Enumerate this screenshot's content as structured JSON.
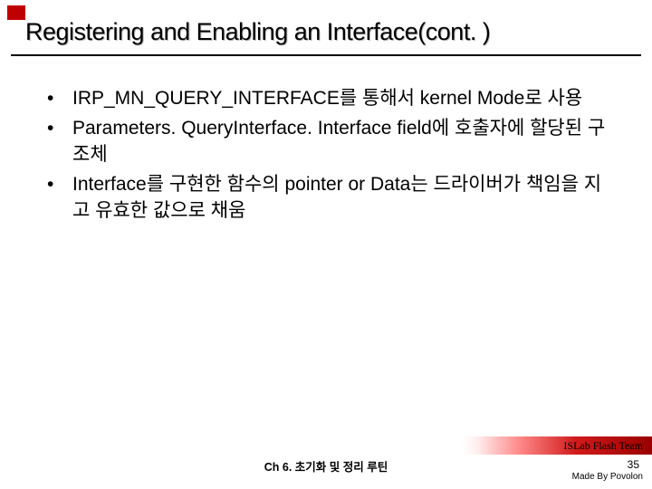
{
  "title": "Registering and Enabling an Interface(cont. )",
  "bullets": [
    "IRP_MN_QUERY_INTERFACE를 통해서 kernel Mode로 사용",
    "Parameters. QueryInterface. Interface field에 호출자에 할당된 구조체",
    "Interface를 구현한 함수의 pointer or Data는 드라이버가 책임을 지고 유효한 값으로 채움"
  ],
  "footer_team": "ISLab Flash Team",
  "chapter": "Ch 6. 초기화 및 정리 루틴",
  "page_number": "35",
  "made_by": "Made By Povolon"
}
